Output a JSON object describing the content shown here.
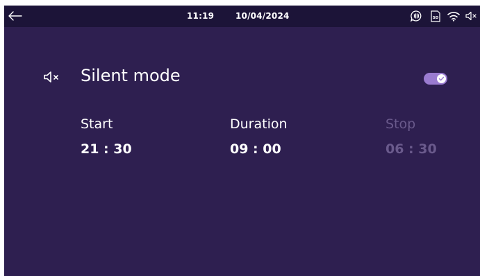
{
  "status_bar": {
    "time": "11:19",
    "date": "10/04/2024",
    "icons": [
      "back-arrow-icon",
      "intercom-icon",
      "sd-card-icon",
      "wifi-icon",
      "mute-icon"
    ]
  },
  "silent_mode": {
    "title": "Silent mode",
    "icon": "speaker-muted-icon",
    "enabled": true
  },
  "schedule": {
    "start": {
      "label": "Start",
      "value": "21 : 30"
    },
    "duration": {
      "label": "Duration",
      "value": "09 : 00"
    },
    "stop": {
      "label": "Stop",
      "value": "06 : 30"
    }
  },
  "colors": {
    "background": "#2e1f50",
    "status_bar": "#1c1438",
    "toggle_on": "#9a7bd0",
    "disabled_text": "#6a5a8c"
  }
}
